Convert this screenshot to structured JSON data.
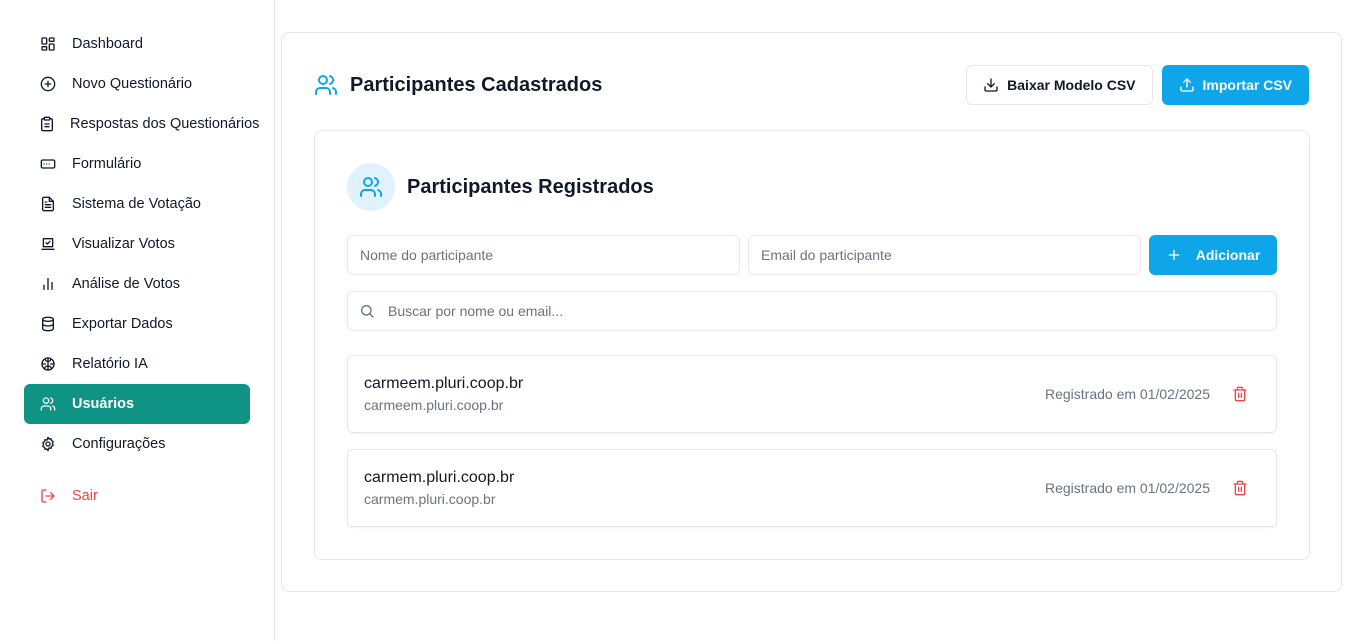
{
  "sidebar": {
    "items": [
      {
        "label": "Dashboard",
        "icon": "dashboard-icon"
      },
      {
        "label": "Novo Questionário",
        "icon": "plus-circle-icon"
      },
      {
        "label": "Respostas dos Questionários",
        "icon": "clipboard-icon"
      },
      {
        "label": "Formulário",
        "icon": "form-input-icon"
      },
      {
        "label": "Sistema de Votação",
        "icon": "file-text-icon"
      },
      {
        "label": "Visualizar Votos",
        "icon": "ballot-box-icon"
      },
      {
        "label": "Análise de Votos",
        "icon": "bar-chart-icon"
      },
      {
        "label": "Exportar Dados",
        "icon": "database-icon"
      },
      {
        "label": "Relatório IA",
        "icon": "brain-icon"
      },
      {
        "label": "Usuários",
        "icon": "users-icon",
        "active": true
      },
      {
        "label": "Configurações",
        "icon": "gear-icon"
      }
    ],
    "logout_label": "Sair"
  },
  "header": {
    "title": "Participantes Cadastrados",
    "download_label": "Baixar Modelo CSV",
    "import_label": "Importar CSV"
  },
  "section": {
    "title": "Participantes Registrados"
  },
  "form": {
    "name_placeholder": "Nome do participante",
    "email_placeholder": "Email do participante",
    "add_label": "Adicionar"
  },
  "search": {
    "placeholder": "Buscar por nome ou email..."
  },
  "participants": [
    {
      "name": "carmeem.pluri.coop.br",
      "email": "carmeem.pluri.coop.br",
      "registered": "Registrado em 01/02/2025"
    },
    {
      "name": "carmem.pluri.coop.br",
      "email": "carmem.pluri.coop.br",
      "registered": "Registrado em 01/02/2025"
    }
  ],
  "colors": {
    "accent": "#0ea5e9",
    "active_nav": "#0e9384",
    "danger": "#ef4444"
  }
}
